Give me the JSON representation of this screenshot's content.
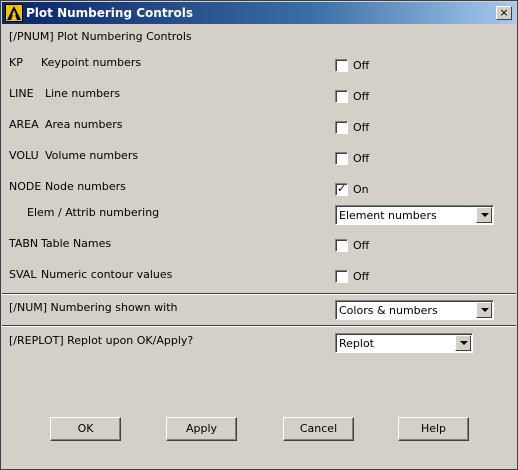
{
  "window": {
    "title": "Plot Numbering Controls",
    "close_symbol": "×"
  },
  "header": {
    "label": "[/PNUM]  Plot Numbering Controls"
  },
  "rows": [
    {
      "code": "KP",
      "label": "Keypoint numbers",
      "checked": false,
      "state": "Off"
    },
    {
      "code": "LINE",
      "label": "Line numbers",
      "checked": false,
      "state": "Off"
    },
    {
      "code": "AREA",
      "label": "Area numbers",
      "checked": false,
      "state": "Off"
    },
    {
      "code": "VOLU",
      "label": "Volume numbers",
      "checked": false,
      "state": "Off"
    },
    {
      "code": "NODE",
      "label": "Node numbers",
      "checked": true,
      "state": "On"
    },
    {
      "code": "TABN",
      "label": "Table Names",
      "checked": false,
      "state": "Off"
    },
    {
      "code": "SVAL",
      "label": "Numeric contour values",
      "checked": false,
      "state": "Off"
    }
  ],
  "elem_attrib": {
    "label": "Elem / Attrib numbering",
    "value": "Element numbers"
  },
  "num": {
    "label": "[/NUM]  Numbering shown with",
    "value": "Colors & numbers"
  },
  "replot": {
    "label": "[/REPLOT] Replot upon OK/Apply?",
    "value": "Replot"
  },
  "buttons": {
    "ok": "OK",
    "apply": "Apply",
    "cancel": "Cancel",
    "help": "Help"
  },
  "icons": {
    "app": "ansys-logo-icon",
    "close": "close-icon",
    "check": "checkmark-icon",
    "dropdown": "chevron-down-icon"
  },
  "colors": {
    "titlebar_start": "#0a246a",
    "titlebar_end": "#a6caf0",
    "dialog_bg": "#d4d0c8",
    "logo": "#f2c300"
  }
}
